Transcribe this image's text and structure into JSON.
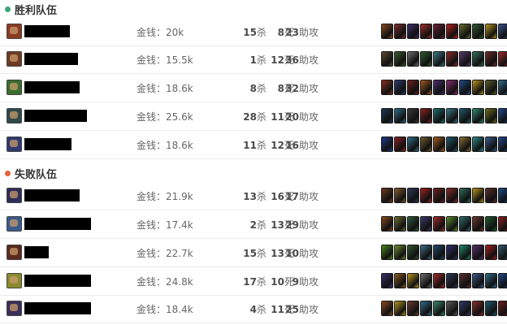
{
  "teams": [
    {
      "title": "胜利队伍",
      "dot_color": "#3aa57a",
      "players": [
        {
          "avatar_color": "#8a3b22",
          "gold_label": "金钱：",
          "gold": "20k",
          "kills": "15",
          "deaths": "8",
          "assists": "23",
          "items": [
            "#8b4a1e",
            "#7a2a2a",
            "#3b2e6e",
            "#a32a2a",
            "#6e2233",
            "#b81e1e",
            "#6b6b2e",
            "#2e5a2e",
            "#b8941e",
            "#3a4f8a"
          ]
        },
        {
          "avatar_color": "#6e3a22",
          "gold_label": "金钱：",
          "gold": "15.5k",
          "kills": "1",
          "deaths": "12",
          "assists": "36",
          "items": [
            "#5a4a2e",
            "#3a5a2e",
            "#6e6e6e",
            "#2e5a2e",
            "#3a7a8a",
            "#8a2a2a",
            "#5a3a6e",
            "#2e6e5a",
            "#6e2a2a",
            "#a32a2a"
          ]
        },
        {
          "avatar_color": "#3a6e2e",
          "gold_label": "金钱：",
          "gold": "18.6k",
          "kills": "8",
          "deaths": "8",
          "assists": "32",
          "items": [
            "#8a2e1e",
            "#2e3a6e",
            "#6e1e1e",
            "#a35a1e",
            "#4a2e6e",
            "#8a2a6e",
            "#1e4a8a",
            "#b8941e",
            "#5a5a2e",
            "#2e6e8a"
          ]
        },
        {
          "avatar_color": "#2e4a4a",
          "gold_label": "金钱：",
          "gold": "25.6k",
          "kills": "28",
          "deaths": "11",
          "assists": "20",
          "items": [
            "#1e3a5a",
            "#2e6e8a",
            "#3a3a3a",
            "#8a1e1e",
            "#1e6e6e",
            "#3a7a8a",
            "#1e5a6e",
            "#2e8a6e",
            "#6e6e1e",
            "#1e4a8a"
          ]
        },
        {
          "avatar_color": "#2e3a6e",
          "gold_label": "金钱：",
          "gold": "18.6k",
          "kills": "11",
          "deaths": "12",
          "assists": "16",
          "items": [
            "#1e3a8a",
            "#8a1e1e",
            "#2e6e8a",
            "#6e5a2e",
            "#a35a1e",
            "#1e5a6e",
            "#8a6e2e",
            "#2e8a8a",
            "#3a5a8a",
            "#1e4a8a"
          ]
        }
      ]
    },
    {
      "title": "失败队伍",
      "dot_color": "#e0653a",
      "players": [
        {
          "avatar_color": "#2e2e5a",
          "gold_label": "金钱：",
          "gold": "21.9k",
          "kills": "13",
          "deaths": "16",
          "assists": "17",
          "items": [
            "#6e3a1e",
            "#8a5a2e",
            "#2e3a5a",
            "#a31e1e",
            "#6e1e1e",
            "#8a2a2a",
            "#2e6e5a",
            "#b8941e",
            "#5a2e2e",
            "#1e4a8a"
          ]
        },
        {
          "avatar_color": "#3a5a8a",
          "gold_label": "金钱：",
          "gold": "17.4k",
          "kills": "2",
          "deaths": "13",
          "assists": "29",
          "items": [
            "#8a4a1e",
            "#6e6e2e",
            "#2e5a3a",
            "#3a3a6e",
            "#a32a2a",
            "#5a8a2e",
            "#2e6e6e",
            "#6e3a2e",
            "#1e5a2e",
            "#8a1e1e"
          ]
        },
        {
          "avatar_color": "#5a2a1e",
          "gold_label": "金钱：",
          "gold": "22.7k",
          "kills": "15",
          "deaths": "13",
          "assists": "10",
          "items": [
            "#4a8a1e",
            "#6e8a2e",
            "#2e5a2e",
            "#3a6e8a",
            "#1e4a6e",
            "#2e2e6e",
            "#1e8a6e",
            "#5a2e6e",
            "#a31e1e",
            "#2e5a6e"
          ]
        },
        {
          "avatar_color": "#8a8a2e",
          "gold_label": "金钱：",
          "gold": "24.8k",
          "kills": "17",
          "deaths": "10",
          "assists": "9",
          "items": [
            "#3a2e6e",
            "#8a5a1e",
            "#b8941e",
            "#6e6e6e",
            "#a32a2a",
            "#2e3a5a",
            "#5a2e2e",
            "#3a5a8a",
            "#2e6e8a",
            "#1e4a8a"
          ]
        },
        {
          "avatar_color": "#3a2e5a",
          "gold_label": "金钱：",
          "gold": "18.4k",
          "kills": "4",
          "deaths": "11",
          "assists": "25",
          "items": [
            "#8a4a1e",
            "#b8941e",
            "#6e3a2e",
            "#2e6e8a",
            "#3a8a6e",
            "#5a5a5a",
            "#2e3a6e",
            "#8a2a2a",
            "#1e5a6e",
            "#6e1e1e"
          ]
        }
      ]
    }
  ],
  "labels": {
    "kills": "杀",
    "deaths": "死",
    "assists": "助攻"
  }
}
